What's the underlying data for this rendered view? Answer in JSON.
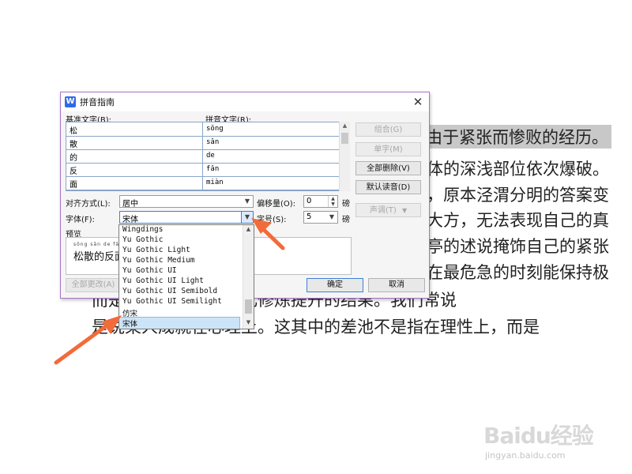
{
  "document": {
    "lines": [
      "由于紧张而惨败的经历。",
      "体的深浅部位依次爆破。",
      "，原本泾渭分明的答案变",
      "大方，无法表现自己的真",
      "亭的述说掩饰自己的紧张",
      "在最危急的时刻能保持极",
      "而是一种长期潜移默化修炼提升的结果。我们常说",
      "是说某人成就在心理上。这其中的差池不是指在理性上，而是"
    ]
  },
  "dialog": {
    "title": "拼音指南",
    "app_icon_letter": "W",
    "close_glyph": "✕",
    "base_text_label": "基准文字(B):",
    "pinyin_text_label": "拼音文字(R):",
    "rows": [
      {
        "base": "松",
        "pinyin": "sōng"
      },
      {
        "base": "散",
        "pinyin": "sǎn"
      },
      {
        "base": "的",
        "pinyin": "de"
      },
      {
        "base": "反",
        "pinyin": "fǎn"
      },
      {
        "base": "面",
        "pinyin": "miàn"
      }
    ],
    "buttons": {
      "combine": "组合(G)",
      "single": "单字(M)",
      "delete_all": "全部删除(V)",
      "default_reading": "默认读音(D)",
      "tone": "声调(T)",
      "apply_all": "全部更改(A)",
      "ok": "确定",
      "cancel": "取消"
    },
    "align_label": "对齐方式(L):",
    "align_value": "居中",
    "offset_label": "偏移量(O):",
    "offset_value": "0",
    "offset_unit": "磅",
    "font_label": "字体(F):",
    "font_value": "宋体",
    "size_label": "字号(S):",
    "size_value": "5",
    "size_unit": "磅",
    "preview_label": "预览",
    "preview_pinyin": "sōng sǎn de fǎn miàn",
    "preview_text": "松散的反面"
  },
  "font_dropdown": {
    "items": [
      "Wingdings",
      "Yu Gothic",
      "Yu Gothic Light",
      "Yu Gothic Medium",
      "Yu Gothic UI",
      "Yu Gothic UI Light",
      "Yu Gothic UI Semibold",
      "Yu Gothic UI Semilight",
      "仿宋",
      "宋体"
    ],
    "selected": "宋体"
  },
  "watermark": {
    "brand": "Baidu经验",
    "url": "jingyan.baidu.com"
  },
  "colors": {
    "annotation_arrow": "#f26b3a",
    "dialog_border": "#a874c8",
    "selection": "#cce4f7",
    "text_highlight": "#c8c8c8"
  },
  "icons": {
    "app": "wps-writer-icon",
    "close": "close-icon",
    "dropdown": "chevron-down-icon"
  }
}
